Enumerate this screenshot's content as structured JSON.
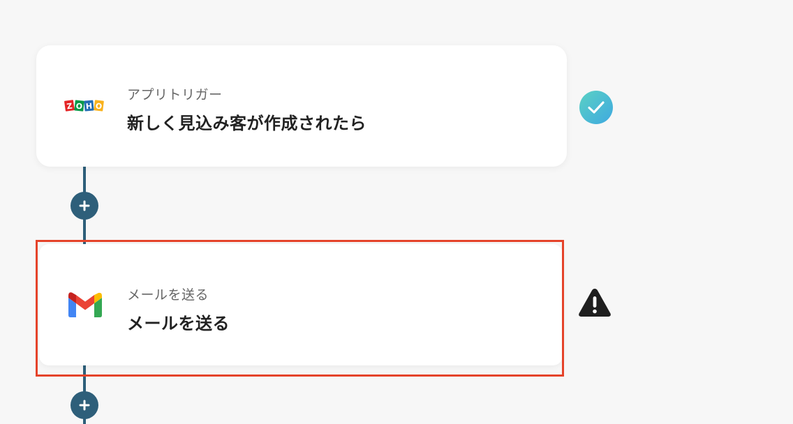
{
  "steps": [
    {
      "subtitle": "アプリトリガー",
      "title": "新しく見込み客が作成されたら",
      "app_icon": "zoho-logo",
      "status_icon": "check-circle-icon",
      "status": "complete"
    },
    {
      "subtitle": "メールを送る",
      "title": "メールを送る",
      "app_icon": "gmail-logo",
      "status_icon": "warning-triangle-icon",
      "status": "warning",
      "highlighted": true
    }
  ],
  "colors": {
    "background": "#f7f7f7",
    "connector": "#2e5f7a",
    "highlight_border": "#e5432a",
    "check_gradient_start": "#5ad1c4",
    "check_gradient_end": "#3fa9e0"
  }
}
